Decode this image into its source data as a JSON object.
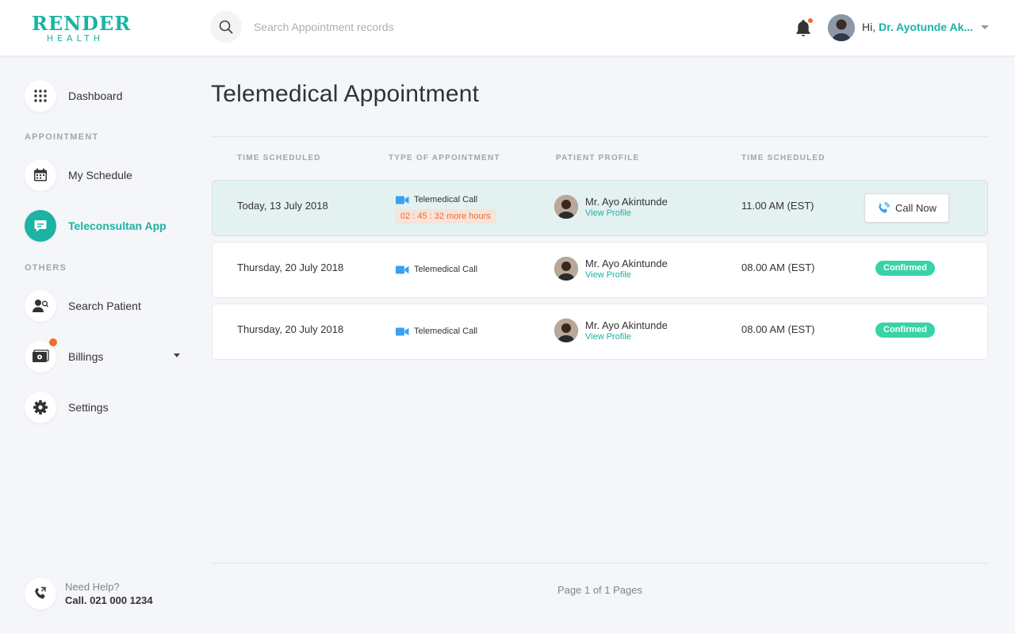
{
  "brand": {
    "line1": "RENDER",
    "line2": "HEALTH",
    "color": "#1bb3a3"
  },
  "search": {
    "placeholder": "Search Appointment records"
  },
  "user": {
    "greeting_prefix": "Hi,",
    "name": "Dr. Ayotunde Ak..."
  },
  "sidebar": {
    "dashboard": "Dashboard",
    "appointment_section": "APPOINTMENT",
    "my_schedule": "My Schedule",
    "teleconsult": "Teleconsultan App",
    "others_section": "OTHERS",
    "search_patient": "Search Patient",
    "billings": "Billings",
    "settings": "Settings",
    "help_label": "Need Help?",
    "help_phone": "Call. 021 000 1234"
  },
  "page": {
    "title": "Telemedical Appointment"
  },
  "columns": [
    "TIME SCHEDULED",
    "TYPE OF APPOINTMENT",
    "PATIENT PROFILE",
    "TIME SCHEDULED"
  ],
  "rows": [
    {
      "date": "Today, 13 July 2018",
      "type": "Telemedical Call",
      "countdown": "02 : 45 : 32 more hours",
      "patient": "Mr. Ayo Akintunde",
      "profile_link": "View Profile",
      "time": "11.00 AM (EST)",
      "action": "Call Now"
    },
    {
      "date": "Thursday, 20 July 2018",
      "type": "Telemedical Call",
      "patient": "Mr. Ayo Akintunde",
      "profile_link": "View Profile",
      "time": "08.00 AM (EST)",
      "status": "Confirmed"
    },
    {
      "date": "Thursday, 20 July 2018",
      "type": "Telemedical Call",
      "patient": "Mr. Ayo Akintunde",
      "profile_link": "View Profile",
      "time": "08.00 AM (EST)",
      "status": "Confirmed"
    }
  ],
  "pagination": {
    "text": "Page 1 of 1 Pages"
  },
  "colors": {
    "accent": "#1bb3a3",
    "notification": "#f26b2a",
    "confirmed": "#38d3a7",
    "video": "#3aa0f0"
  }
}
